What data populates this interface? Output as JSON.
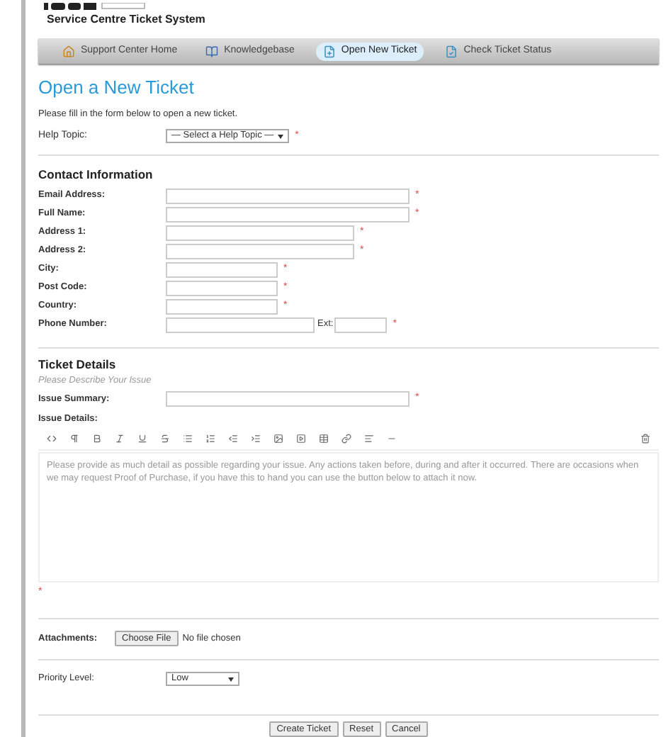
{
  "header": {
    "subtitle": "Service Centre Ticket System"
  },
  "nav": [
    {
      "label": "Support Center Home",
      "kind": "home",
      "selected": false
    },
    {
      "label": "Knowledgebase",
      "kind": "book",
      "selected": false
    },
    {
      "label": "Open New Ticket",
      "kind": "new",
      "selected": true
    },
    {
      "label": "Check Ticket Status",
      "kind": "status",
      "selected": false
    }
  ],
  "page_title": "Open a New Ticket",
  "intro": "Please fill in the form below to open a new ticket.",
  "help_topic": {
    "label": "Help Topic:",
    "value": "— Select a Help Topic —",
    "required": "*"
  },
  "contact": {
    "heading": "Contact Information",
    "fields": [
      {
        "label": "Email Address:",
        "kind": "long",
        "required": "*"
      },
      {
        "label": "Full Name:",
        "kind": "long",
        "required": "*"
      },
      {
        "label": "Address 1:",
        "kind": "medium",
        "required": "*"
      },
      {
        "label": "Address 2:",
        "kind": "medium",
        "required": "*"
      },
      {
        "label": "City:",
        "kind": "short",
        "required": "*"
      },
      {
        "label": "Post Code:",
        "kind": "short",
        "required": "*"
      },
      {
        "label": "Country:",
        "kind": "short",
        "required": "*"
      },
      {
        "label": "Phone Number:",
        "kind": "phone",
        "ext_label": "Ext:",
        "required": "*"
      }
    ]
  },
  "details": {
    "heading": "Ticket Details",
    "subheading": "Please Describe Your Issue",
    "summary_label": "Issue Summary:",
    "summary_required": "*",
    "details_label": "Issue Details:",
    "editor_placeholder": "Please provide as much detail as possible regarding your issue. Any actions taken before, during and after it occurred. There are occasions when we may request Proof of Purchase, if you have this to hand you can use the button below to attach it now.",
    "details_required": "*"
  },
  "attachments": {
    "label": "Attachments:",
    "button": "Choose File",
    "status": "No file chosen"
  },
  "priority": {
    "label": "Priority Level:",
    "value": "Low"
  },
  "buttons": [
    "Create Ticket",
    "Reset",
    "Cancel"
  ]
}
